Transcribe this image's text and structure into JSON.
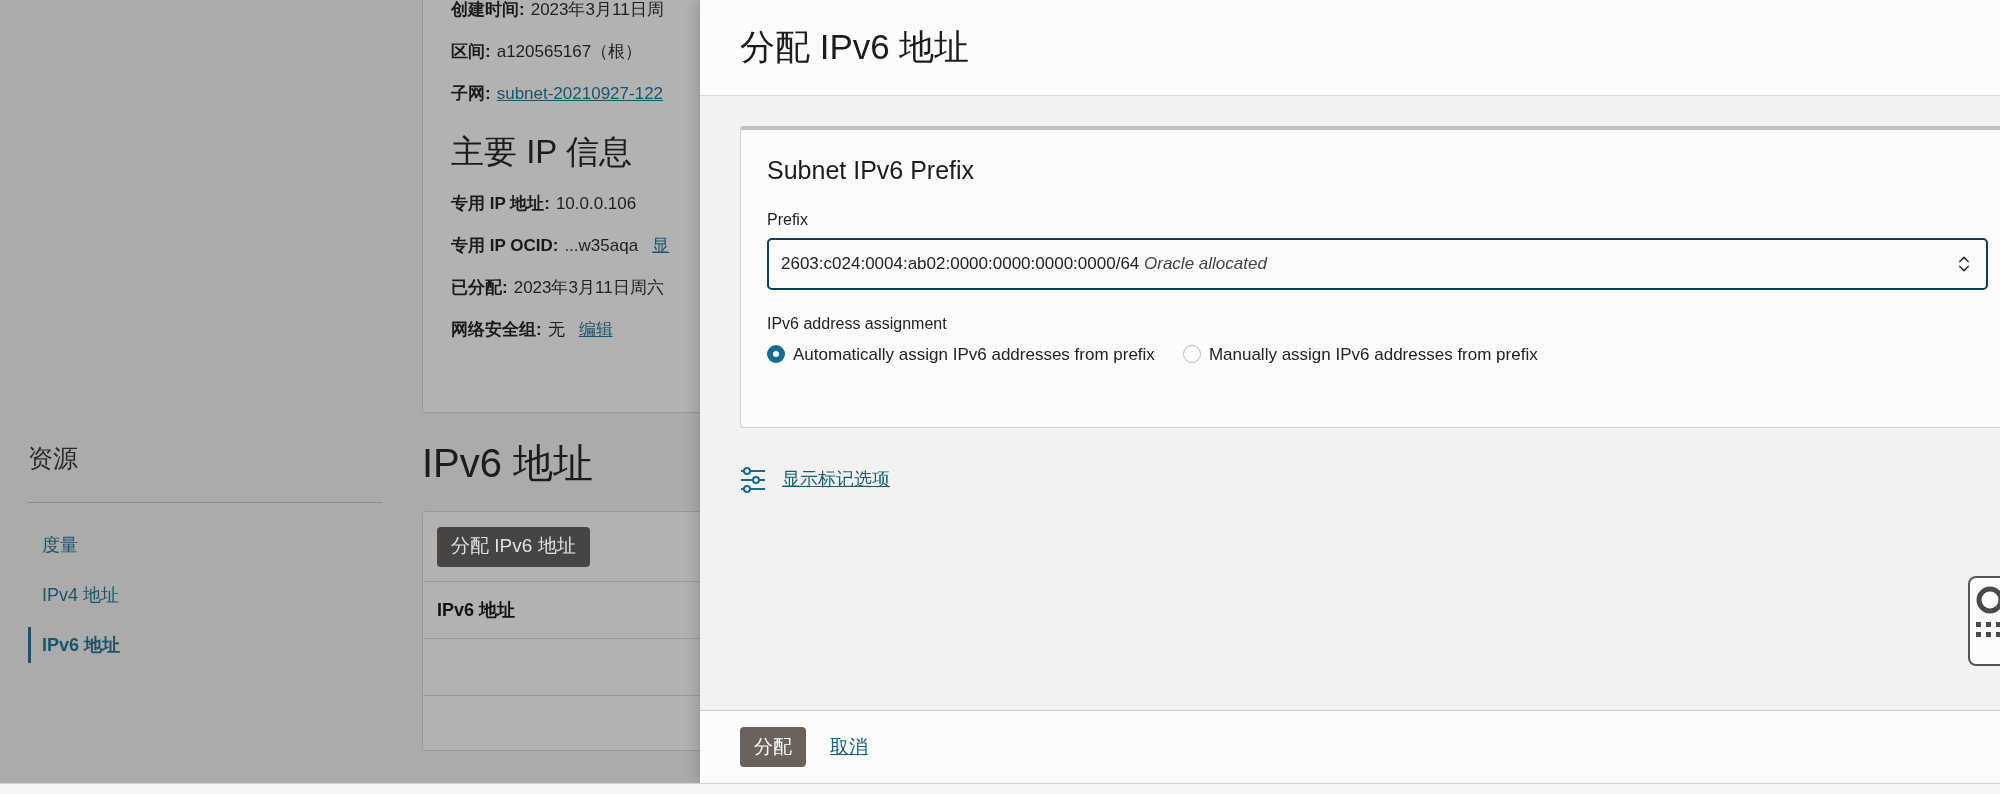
{
  "background": {
    "details": {
      "rows_top": [
        {
          "label": "创建时间:",
          "value": "2023年3月11日周"
        },
        {
          "label": "区间:",
          "value": "a120565167（根）"
        },
        {
          "label": "子网:",
          "link": "subnet-20210927-122"
        }
      ],
      "section_title": "主要 IP 信息",
      "rows": [
        {
          "label": "专用 IP 地址:",
          "value": "10.0.0.106"
        },
        {
          "label": "专用 IP OCID:",
          "value": "...w35aqa",
          "link": "显"
        },
        {
          "label": "已分配:",
          "value": "2023年3月11日周六"
        },
        {
          "label": "网络安全组:",
          "value": "无",
          "link": "编辑"
        }
      ]
    },
    "sidebar": {
      "title": "资源",
      "items": [
        {
          "label": "度量",
          "selected": false
        },
        {
          "label": "IPv4 地址",
          "selected": false
        },
        {
          "label": "IPv6 地址",
          "selected": true
        }
      ]
    },
    "content": {
      "title": "IPv6 地址",
      "button": "分配 IPv6 地址",
      "table": {
        "columns": [
          "IPv6 地址"
        ]
      }
    }
  },
  "modal": {
    "title": "分配 IPv6 地址",
    "card_title": "Subnet IPv6 Prefix",
    "prefix": {
      "label": "Prefix",
      "value": "2603:c024:0004:ab02:0000:0000:0000:0000/64",
      "hint": "Oracle allocated"
    },
    "assignment": {
      "label": "IPv6 address assignment",
      "options": [
        {
          "label": "Automatically assign IPv6 addresses from prefix",
          "selected": true
        },
        {
          "label": "Manually assign IPv6 addresses from prefix",
          "selected": false
        }
      ]
    },
    "tags_link": "显示标记选项",
    "footer": {
      "submit": "分配",
      "cancel": "取消"
    }
  }
}
